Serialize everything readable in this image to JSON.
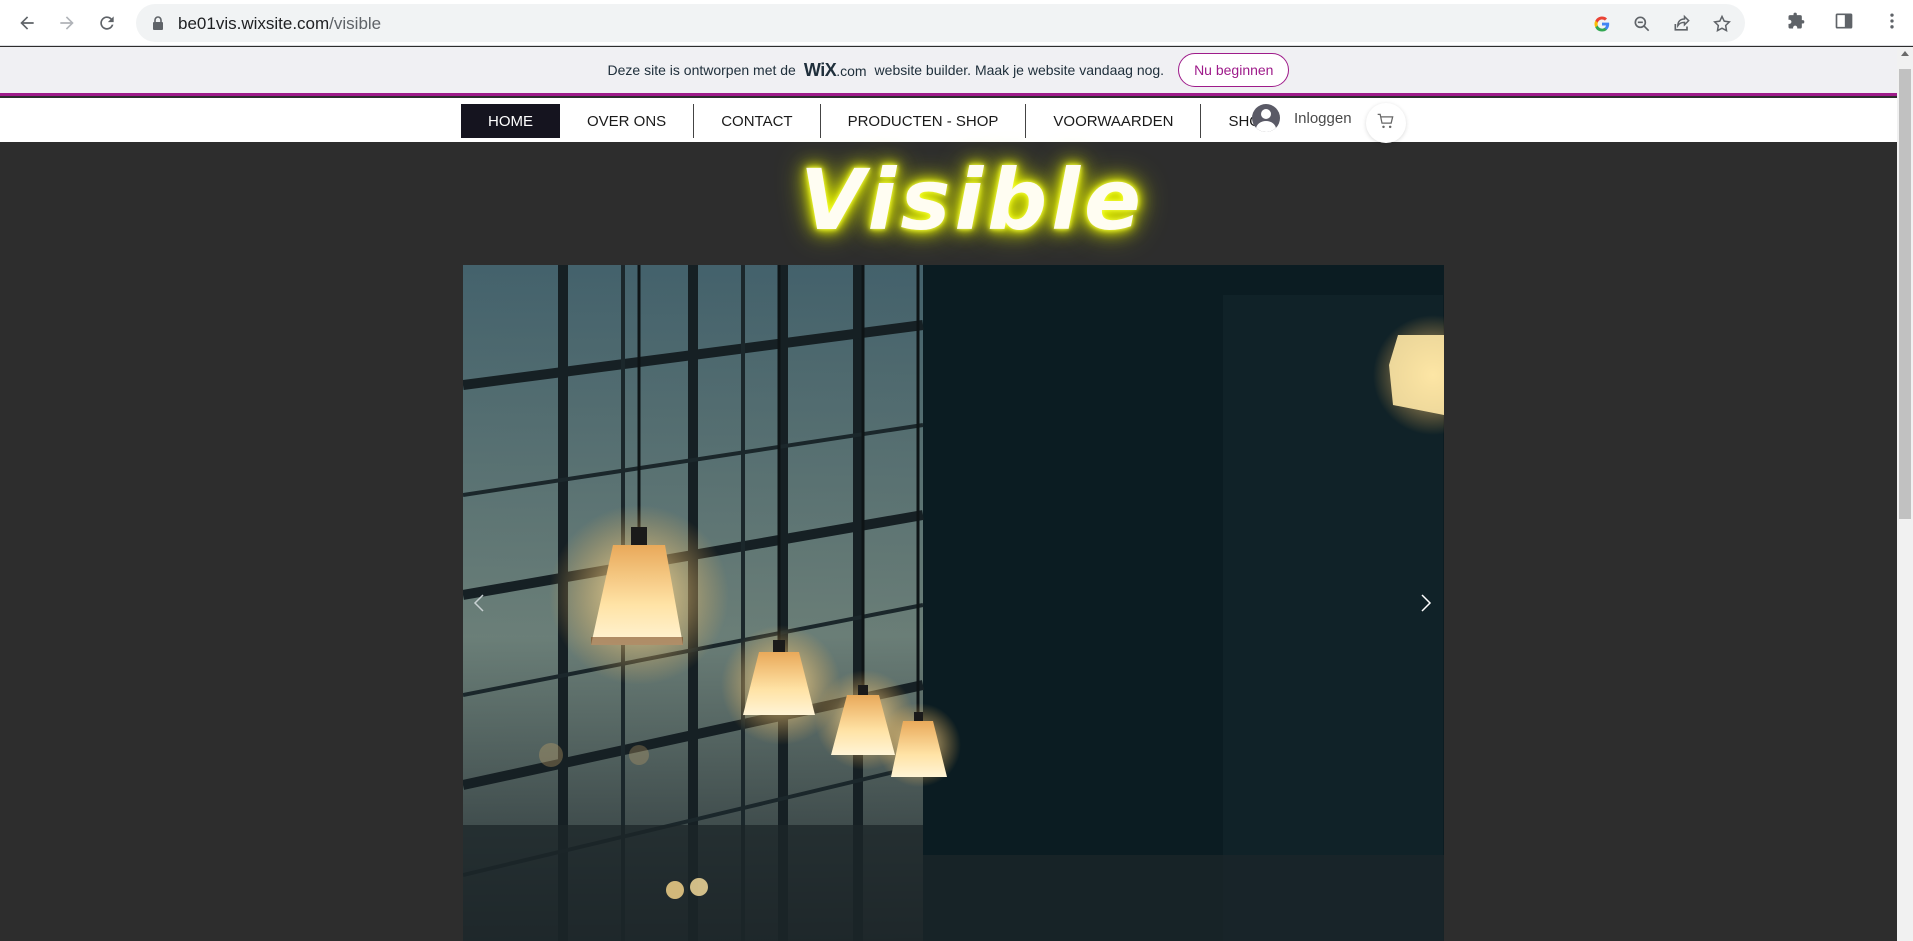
{
  "browser": {
    "url_host": "be01vis.wixsite.com",
    "url_path": "/visible",
    "icons": [
      "back-icon",
      "forward-icon",
      "reload-icon",
      "lock-icon",
      "google-icon",
      "zoom-out-icon",
      "share-icon",
      "star-icon",
      "extensions-icon",
      "side-panel-icon",
      "menu-dots-icon"
    ]
  },
  "wix_banner": {
    "text_before": "Deze site is ontworpen met de",
    "logo": "WiX",
    "logo_suffix": ".com",
    "text_after": "website builder. Maak je website vandaag nog.",
    "button": "Nu beginnen",
    "accent": "#9e1b8a"
  },
  "nav": {
    "items": [
      {
        "label": "HOME"
      },
      {
        "label": "OVER ONS"
      },
      {
        "label": "CONTACT"
      },
      {
        "label": "PRODUCTEN - SHOP"
      },
      {
        "label": "VOORWAARDEN"
      },
      {
        "label": "SHOP"
      }
    ],
    "login_label": "Inloggen"
  },
  "logo": {
    "text": "Visible",
    "glow_color": "#f2ff00"
  },
  "colors": {
    "page_bg": "#2d2d2d",
    "nav_active_bg": "#15141f"
  }
}
